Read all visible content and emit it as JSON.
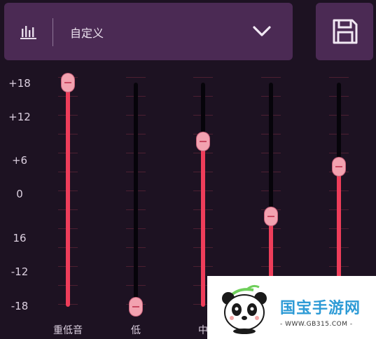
{
  "header": {
    "preset_name": "自定义",
    "icons": {
      "equalizer": "equalizer-icon",
      "dropdown": "chevron-down-icon",
      "save": "save-icon"
    }
  },
  "db_scale": [
    "+18",
    "+12",
    "+6",
    "0",
    "16",
    "-12",
    "-18"
  ],
  "slider_range_db": [
    -18,
    18
  ],
  "bands": [
    {
      "label": "重低音",
      "value_db": 18
    },
    {
      "label": "低",
      "value_db": -18
    },
    {
      "label": "中",
      "value_db": 8.5
    },
    {
      "label": "",
      "value_db": -3.5
    },
    {
      "label": "",
      "value_db": 4.5
    }
  ],
  "watermark": {
    "title": "国宝手游网",
    "url": "- WWW.GB315.COM -"
  },
  "colors": {
    "background": "#1d1222",
    "panel": "#4b2a54",
    "slider_fill": "#ee3d5a",
    "knob": "#f2a2b0"
  }
}
